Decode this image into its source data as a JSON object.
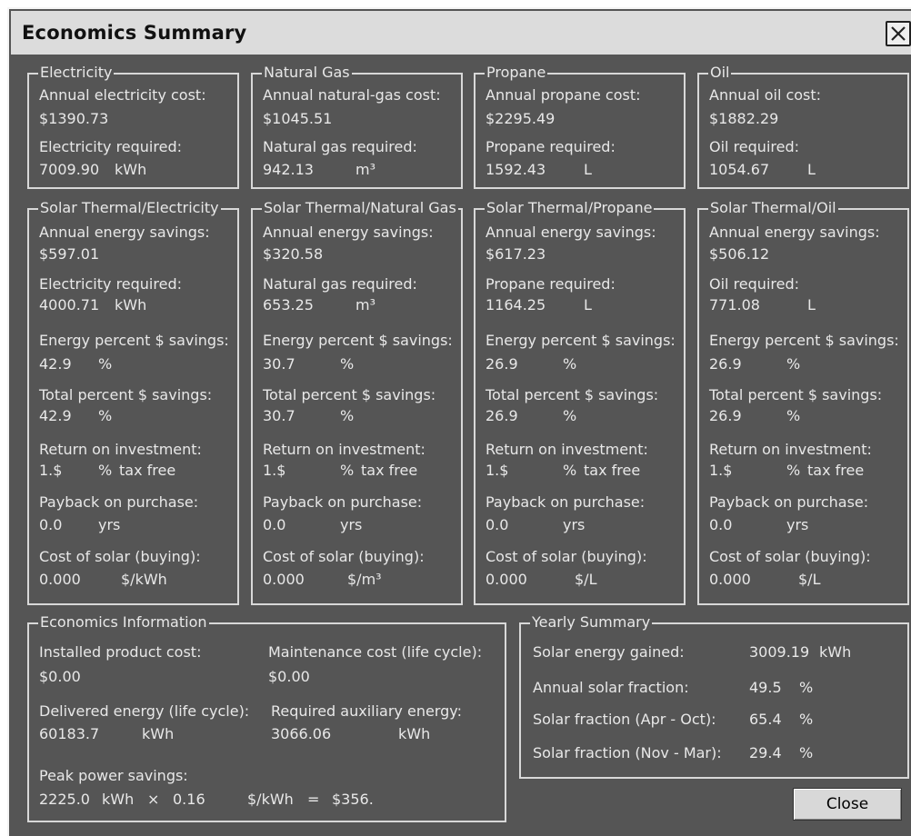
{
  "window": {
    "title": "Economics Summary"
  },
  "top_groups": [
    {
      "title": "Electricity",
      "cost_label": "Annual electricity cost:",
      "cost": "$1390.73",
      "req_label": "Electricity required:",
      "req_value": "7009.90",
      "req_unit": "kWh"
    },
    {
      "title": "Natural Gas",
      "cost_label": "Annual natural-gas cost:",
      "cost": "$1045.51",
      "req_label": "Natural gas required:",
      "req_value": "942.13",
      "req_unit": "m³"
    },
    {
      "title": "Propane",
      "cost_label": "Annual propane cost:",
      "cost": "$2295.49",
      "req_label": "Propane required:",
      "req_value": "1592.43",
      "req_unit": "L"
    },
    {
      "title": "Oil",
      "cost_label": "Annual oil cost:",
      "cost": "$1882.29",
      "req_label": "Oil required:",
      "req_value": "1054.67",
      "req_unit": "L"
    }
  ],
  "solar_labels": {
    "savings": "Annual energy savings:",
    "energy_pct": "Energy percent $ savings:",
    "total_pct": "Total percent $ savings:",
    "roi": "Return on investment:",
    "payback": "Payback on purchase:",
    "cost_solar": "Cost of solar (buying):",
    "pct_unit": "%",
    "tax_free": "tax free",
    "yrs": "yrs"
  },
  "solar_groups": [
    {
      "title": "Solar Thermal/Electricity",
      "savings": "$597.01",
      "req_label": "Electricity required:",
      "req_value": "4000.71",
      "req_unit": "kWh",
      "energy_pct": "42.9",
      "total_pct": "42.9",
      "roi": "1.$",
      "payback": "0.0",
      "cost_value": "0.000",
      "cost_unit": "$/kWh"
    },
    {
      "title": "Solar Thermal/Natural Gas",
      "savings": "$320.58",
      "req_label": "Natural gas required:",
      "req_value": "653.25",
      "req_unit": "m³",
      "energy_pct": "30.7",
      "total_pct": "30.7",
      "roi": "1.$",
      "payback": "0.0",
      "cost_value": "0.000",
      "cost_unit": "$/m³"
    },
    {
      "title": "Solar Thermal/Propane",
      "savings": "$617.23",
      "req_label": "Propane required:",
      "req_value": "1164.25",
      "req_unit": "L",
      "energy_pct": "26.9",
      "total_pct": "26.9",
      "roi": "1.$",
      "payback": "0.0",
      "cost_value": "0.000",
      "cost_unit": "$/L"
    },
    {
      "title": "Solar Thermal/Oil",
      "savings": "$506.12",
      "req_label": "Oil required:",
      "req_value": "771.08",
      "req_unit": "L",
      "energy_pct": "26.9",
      "total_pct": "26.9",
      "roi": "1.$",
      "payback": "0.0",
      "cost_value": "0.000",
      "cost_unit": "$/L"
    }
  ],
  "economics": {
    "title": "Economics Information",
    "installed_label": "Installed product cost:",
    "installed_value": "$0.00",
    "maintenance_label": "Maintenance cost (life cycle):",
    "maintenance_value": "$0.00",
    "delivered_label": "Delivered energy (life cycle):",
    "delivered_value": "60183.7",
    "delivered_unit": "kWh",
    "auxiliary_label": "Required auxiliary energy:",
    "auxiliary_value": "3066.06",
    "auxiliary_unit": "kWh",
    "peak_label": "Peak power savings:",
    "peak_value": "2225.0",
    "peak_unit": "kWh",
    "times": "×",
    "rate": "0.16",
    "rate_unit": "$/kWh",
    "equals": "=",
    "peak_result": "$356."
  },
  "yearly": {
    "title": "Yearly Summary",
    "rows": [
      {
        "label": "Solar energy gained:",
        "value": "3009.19",
        "unit": "kWh"
      },
      {
        "label": "Annual solar fraction:",
        "value": "49.5",
        "unit": "%"
      },
      {
        "label": "Solar fraction (Apr - Oct):",
        "value": "65.4",
        "unit": "%"
      },
      {
        "label": "Solar fraction (Nov - Mar):",
        "value": "29.4",
        "unit": "%"
      }
    ]
  },
  "buttons": {
    "close": "Close"
  }
}
